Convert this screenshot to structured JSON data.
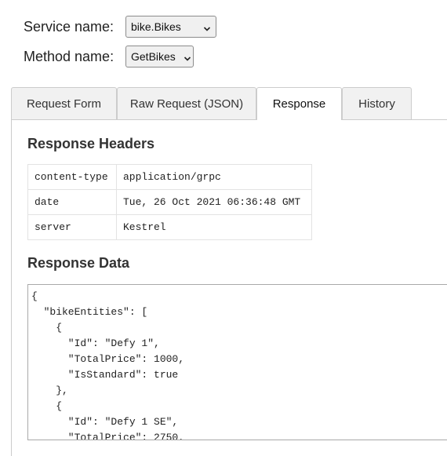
{
  "form": {
    "service_label": "Service name:",
    "service_value": "bike.Bikes",
    "method_label": "Method name:",
    "method_value": "GetBikes"
  },
  "tabs": [
    {
      "label": "Request Form",
      "active": false
    },
    {
      "label": "Raw Request (JSON)",
      "active": false
    },
    {
      "label": "Response",
      "active": true
    },
    {
      "label": "History",
      "active": false
    }
  ],
  "response": {
    "headers_title": "Response Headers",
    "headers": [
      {
        "key": "content-type",
        "value": "application/grpc"
      },
      {
        "key": "date",
        "value": "Tue, 26 Oct 2021 06:36:48 GMT"
      },
      {
        "key": "server",
        "value": "Kestrel"
      }
    ],
    "data_title": "Response Data",
    "data_text": "{\n  \"bikeEntities\": [\n    {\n      \"Id\": \"Defy 1\",\n      \"TotalPrice\": 1000,\n      \"IsStandard\": true\n    },\n    {\n      \"Id\": \"Defy 1 SE\",\n      \"TotalPrice\": 2750,"
  }
}
